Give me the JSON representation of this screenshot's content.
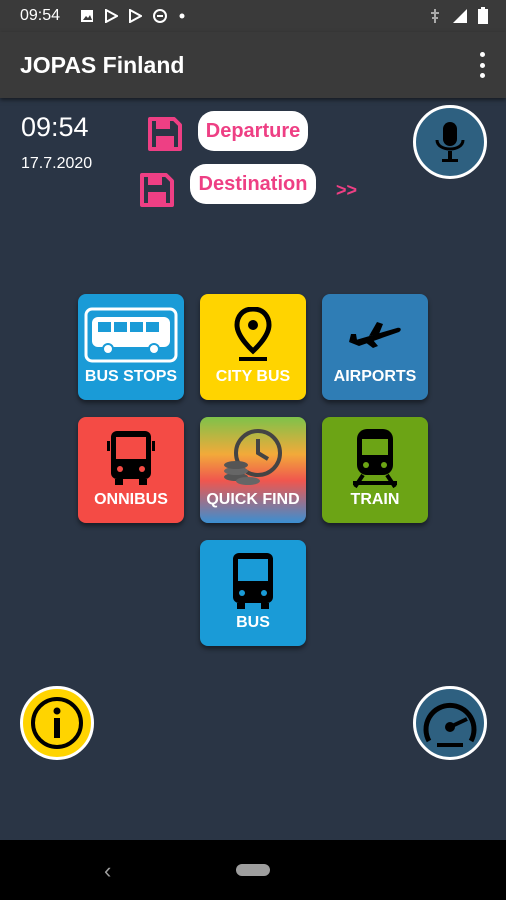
{
  "status_bar": {
    "time": "09:54",
    "left_icons": [
      "image-icon",
      "play-icon",
      "play-icon",
      "circle-icon",
      "dot-icon"
    ],
    "right_icons": [
      "network-icon",
      "signal-icon",
      "battery-icon"
    ]
  },
  "app_bar": {
    "title": "JOPAS Finland",
    "menu_icon": "more-vert-icon"
  },
  "info": {
    "time": "09:54",
    "date": "17.7.2020"
  },
  "route": {
    "departure_label": "Departure",
    "destination_label": "Destination",
    "go_label": ">>",
    "accent_color": "#ee3f84"
  },
  "tiles": [
    {
      "label": "BUS STOPS",
      "icon": "bus-stops-icon",
      "color": "#1a9bd7"
    },
    {
      "label": "CITY BUS",
      "icon": "map-pin-icon",
      "color": "#ffd400"
    },
    {
      "label": "AIRPORTS",
      "icon": "airplane-icon",
      "color": "#2f7db5"
    },
    {
      "label": "ONNIBUS",
      "icon": "onnibus-icon",
      "color": "#f44b45"
    },
    {
      "label": "QUICK FIND",
      "icon": "clock-coins-icon",
      "color": "gradient"
    },
    {
      "label": "TRAIN",
      "icon": "train-icon",
      "color": "#6ca415"
    },
    {
      "label": "BUS",
      "icon": "bus-icon",
      "color": "#1a9bd7"
    }
  ],
  "buttons": {
    "mic_icon": "microphone-icon",
    "info_icon": "info-icon",
    "speed_icon": "speedometer-icon"
  },
  "nav": {
    "back_icon": "back-icon",
    "home_icon": "home-pill-icon"
  }
}
